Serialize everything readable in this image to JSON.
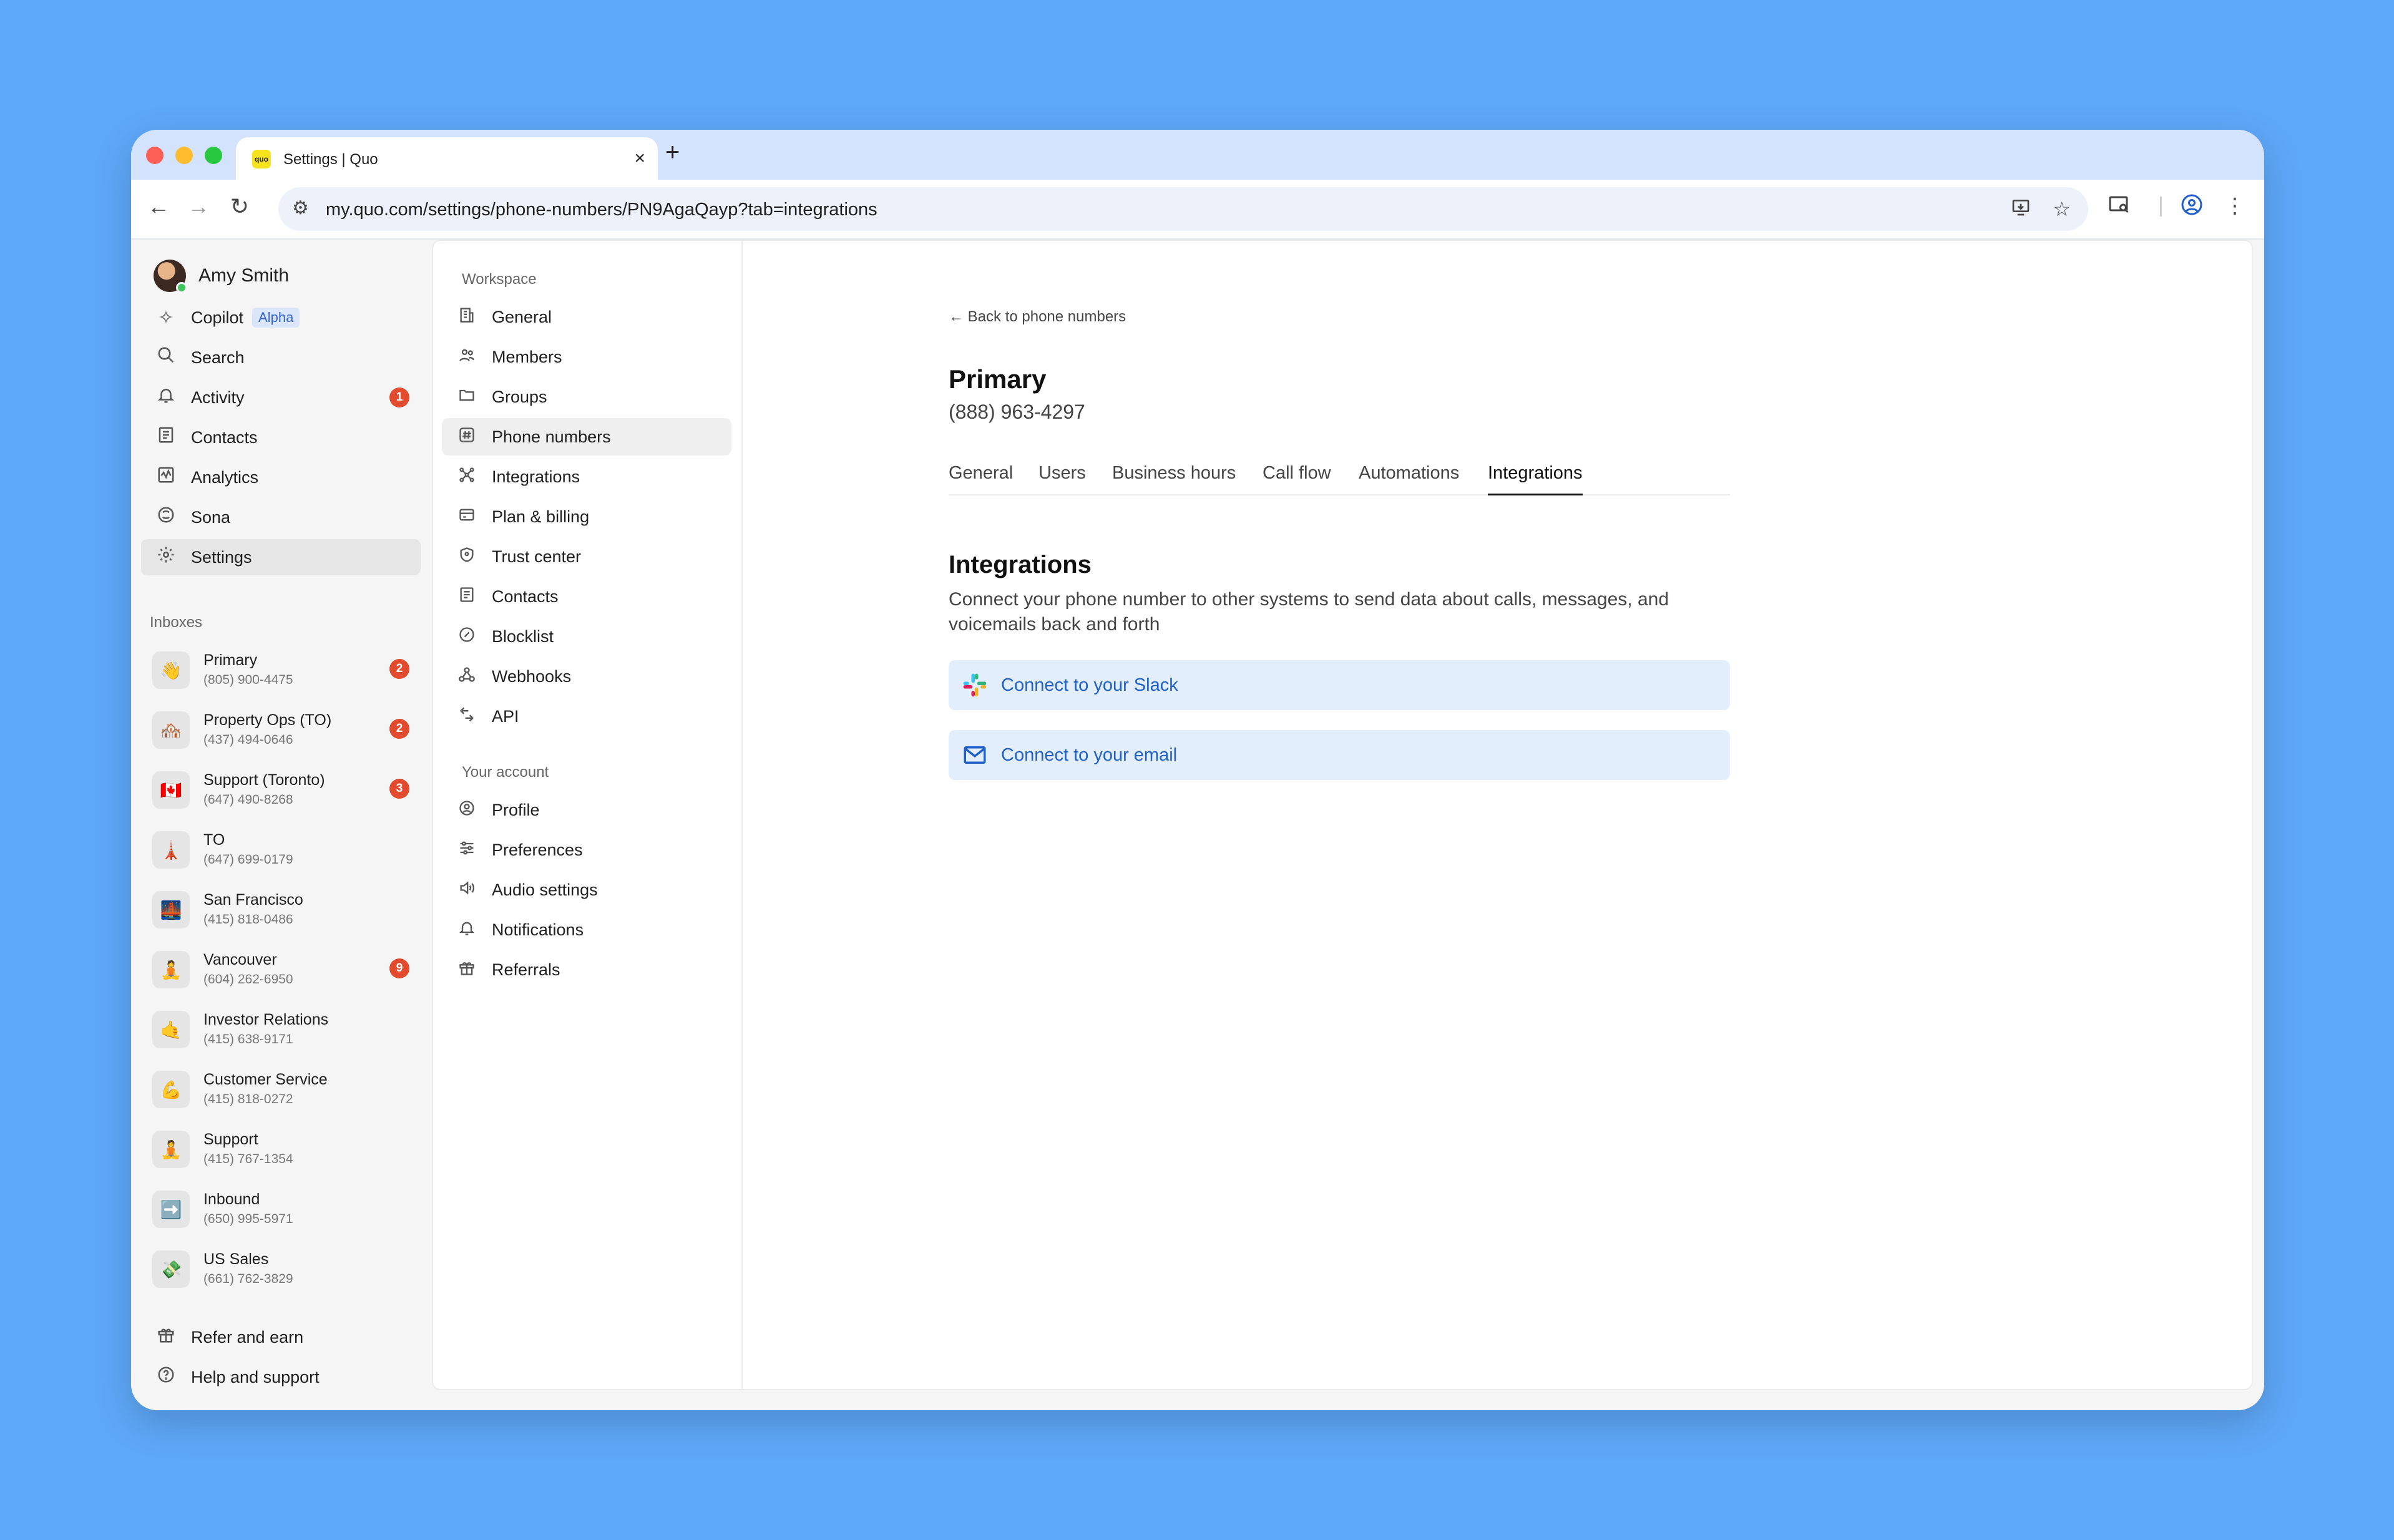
{
  "browser": {
    "tab_title": "Settings | Quo",
    "tab_favicon_text": "quo",
    "url": "my.quo.com/settings/phone-numbers/PN9AgaQayp?tab=integrations"
  },
  "sidebar": {
    "profile_name": "Amy Smith",
    "nav": [
      {
        "label": "Copilot",
        "badge": "Alpha",
        "icon": "sparkle-icon"
      },
      {
        "label": "Search",
        "icon": "search-icon"
      },
      {
        "label": "Activity",
        "count": "1",
        "icon": "bell-icon"
      },
      {
        "label": "Contacts",
        "icon": "contacts-icon"
      },
      {
        "label": "Analytics",
        "icon": "analytics-icon"
      },
      {
        "label": "Sona",
        "icon": "sona-icon"
      },
      {
        "label": "Settings",
        "icon": "gear-icon",
        "active": true
      }
    ],
    "inboxes_label": "Inboxes",
    "inboxes": [
      {
        "name": "Primary",
        "number": "(805) 900-4475",
        "count": "2",
        "emoji": "👋"
      },
      {
        "name": "Property Ops (TO)",
        "number": "(437) 494-0646",
        "count": "2",
        "emoji": "🏘️"
      },
      {
        "name": "Support (Toronto)",
        "number": "(647) 490-8268",
        "count": "3",
        "emoji": "🇨🇦"
      },
      {
        "name": "TO",
        "number": "(647) 699-0179",
        "emoji": "🗼"
      },
      {
        "name": "San Francisco",
        "number": "(415) 818-0486",
        "emoji": "🌉"
      },
      {
        "name": "Vancouver",
        "number": "(604) 262-6950",
        "count": "9",
        "emoji": "🧘"
      },
      {
        "name": "Investor Relations",
        "number": "(415) 638-9171",
        "emoji": "🤙"
      },
      {
        "name": "Customer Service",
        "number": "(415) 818-0272",
        "emoji": "💪"
      },
      {
        "name": "Support",
        "number": "(415) 767-1354",
        "emoji": "🧘"
      },
      {
        "name": "Inbound",
        "number": "(650) 995-5971",
        "emoji": "➡️"
      },
      {
        "name": "US Sales",
        "number": "(661) 762-3829",
        "emoji": "💸"
      }
    ],
    "footer": [
      {
        "label": "Refer and earn",
        "icon": "gift-icon"
      },
      {
        "label": "Help and support",
        "icon": "help-icon"
      }
    ]
  },
  "settings_nav": {
    "workspace_label": "Workspace",
    "workspace": [
      {
        "label": "General",
        "icon": "building-icon"
      },
      {
        "label": "Members",
        "icon": "members-icon"
      },
      {
        "label": "Groups",
        "icon": "folder-icon"
      },
      {
        "label": "Phone numbers",
        "icon": "hash-icon",
        "active": true
      },
      {
        "label": "Integrations",
        "icon": "integrations-icon"
      },
      {
        "label": "Plan & billing",
        "icon": "card-icon"
      },
      {
        "label": "Trust center",
        "icon": "shield-icon"
      },
      {
        "label": "Contacts",
        "icon": "contacts-icon"
      },
      {
        "label": "Blocklist",
        "icon": "block-icon"
      },
      {
        "label": "Webhooks",
        "icon": "webhook-icon"
      },
      {
        "label": "API",
        "icon": "api-icon"
      }
    ],
    "account_label": "Your account",
    "account": [
      {
        "label": "Profile",
        "icon": "profile-icon"
      },
      {
        "label": "Preferences",
        "icon": "sliders-icon"
      },
      {
        "label": "Audio settings",
        "icon": "speaker-icon"
      },
      {
        "label": "Notifications",
        "icon": "bell-icon"
      },
      {
        "label": "Referrals",
        "icon": "gift-icon"
      }
    ]
  },
  "main": {
    "back_link": "Back to phone numbers",
    "title": "Primary",
    "phone": "(888) 963-4297",
    "tabs": [
      "General",
      "Users",
      "Business hours",
      "Call flow",
      "Automations",
      "Integrations"
    ],
    "active_tab": "Integrations",
    "section_title": "Integrations",
    "section_desc": "Connect your phone number to other systems to send data about calls, messages, and voicemails back and forth",
    "connect_slack": "Connect to your Slack",
    "connect_email": "Connect to your email"
  }
}
